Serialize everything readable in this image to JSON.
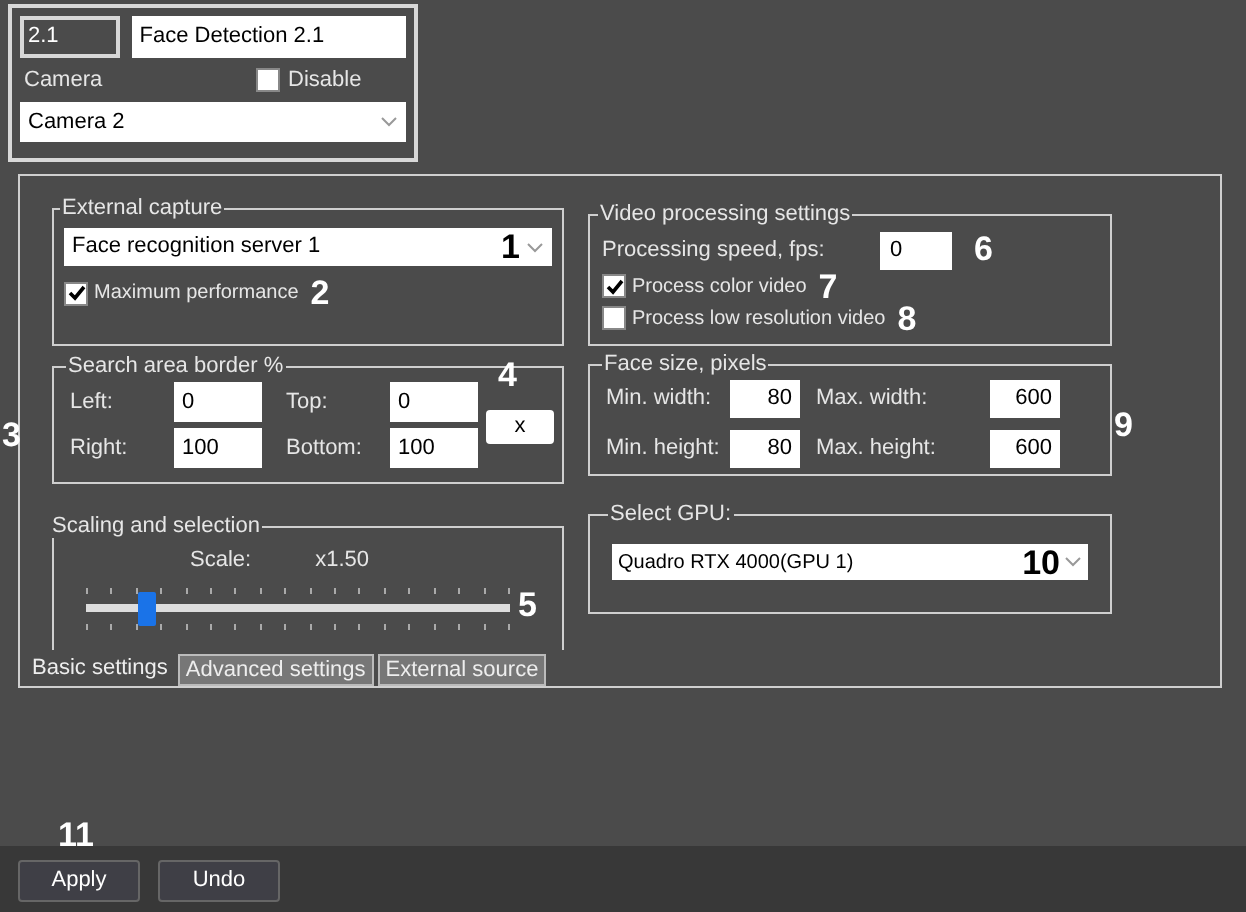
{
  "detector": {
    "id": "2.1",
    "name": "Face Detection 2.1",
    "camera_label": "Camera",
    "disable": {
      "label": "Disable",
      "checked": false
    },
    "camera": "Camera 2"
  },
  "external_capture": {
    "title": "External capture",
    "server": "Face recognition server 1",
    "maximum_performance": {
      "label": "Maximum performance",
      "checked": true
    }
  },
  "search_area": {
    "title": "Search area border %",
    "fields": [
      {
        "label": "Left:",
        "value": "0"
      },
      {
        "label": "Top:",
        "value": "0"
      },
      {
        "label": "Right:",
        "value": "100"
      },
      {
        "label": "Bottom:",
        "value": "100"
      }
    ],
    "clear_button": "x"
  },
  "scaling": {
    "title": "Scaling and selection",
    "scale_label": "Scale:",
    "scale_value": "x1.50",
    "level": 0.14
  },
  "video_processing": {
    "title": "Video processing settings",
    "speed_label": "Processing speed, fps:",
    "speed": "0",
    "options": [
      {
        "label": "Process color video",
        "checked": true
      },
      {
        "label": "Process low resolution video",
        "checked": false
      }
    ]
  },
  "face_size": {
    "title": "Face size, pixels",
    "fields": [
      {
        "label": "Min. width:",
        "value": "80"
      },
      {
        "label": "Max. width:",
        "value": "600"
      },
      {
        "label": "Min. height:",
        "value": "80"
      },
      {
        "label": "Max. height:",
        "value": "600"
      }
    ]
  },
  "gpu": {
    "title": "Select GPU:",
    "value": "Quadro RTX 4000(GPU 1)"
  },
  "tabs": [
    {
      "label": "Basic settings",
      "selected": true
    },
    {
      "label": "Advanced settings",
      "selected": false
    },
    {
      "label": "External source",
      "selected": false
    }
  ],
  "buttons": [
    "Apply",
    "Undo"
  ],
  "callouts": [
    "1",
    "2",
    "3",
    "4",
    "5",
    "6",
    "7",
    "8",
    "9",
    "10",
    "11"
  ]
}
